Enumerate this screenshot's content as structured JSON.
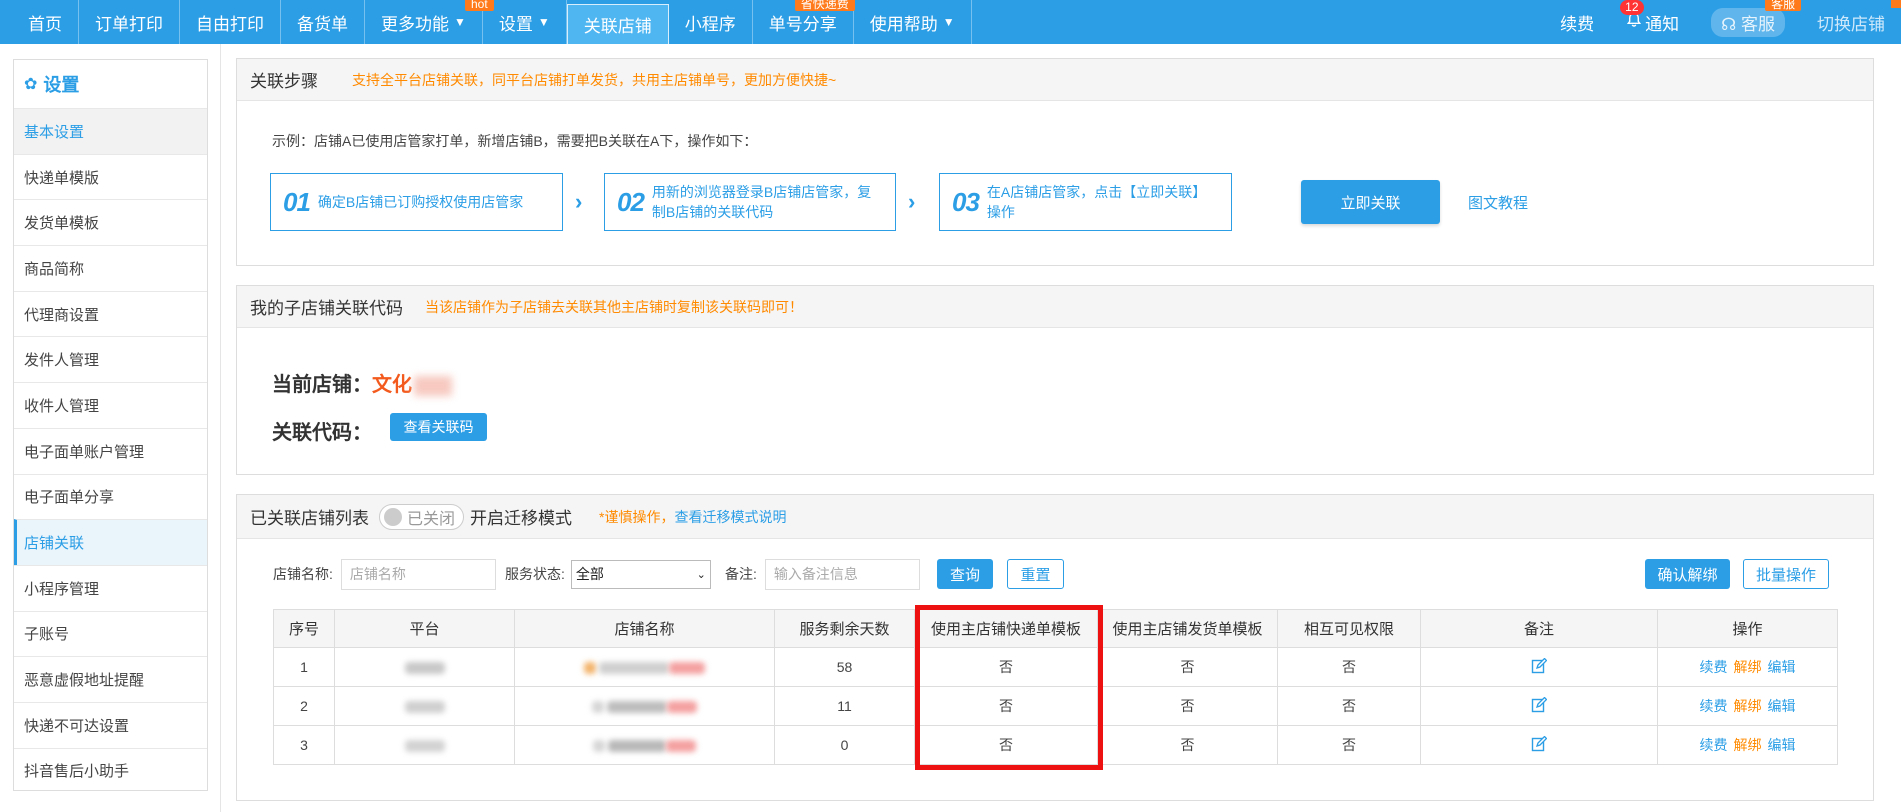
{
  "nav": {
    "items": [
      {
        "label": "首页"
      },
      {
        "label": "订单打印"
      },
      {
        "label": "自由打印"
      },
      {
        "label": "备货单"
      },
      {
        "label": "更多功能",
        "arrow": "▼",
        "badge": "hot"
      },
      {
        "label": "设置",
        "arrow": "▼"
      },
      {
        "label": "关联店铺",
        "active": true
      },
      {
        "label": "小程序"
      },
      {
        "label": "单号分享",
        "badge": "省快递费"
      },
      {
        "label": "使用帮助",
        "arrow": "▼"
      }
    ],
    "right": {
      "renew": "续费",
      "notify": "通知",
      "notify_count": "12",
      "kefu": "客服",
      "kefu_badge": "客服",
      "switch": "切换店铺"
    }
  },
  "sidebar": {
    "title": "设置",
    "items": [
      "基本设置",
      "快递单模版",
      "发货单模板",
      "商品简称",
      "代理商设置",
      "发件人管理",
      "收件人管理",
      "电子面单账户管理",
      "电子面单分享",
      "店铺关联",
      "小程序管理",
      "子账号",
      "恶意虚假地址提醒",
      "快递不可达设置",
      "抖音售后小助手"
    ],
    "active_index": 9
  },
  "steps_panel": {
    "title": "关联步骤",
    "hint": "支持全平台店铺关联，同平台店铺打单发货，共用主店铺单号，更加方便快捷~",
    "example": "示例：店铺A已使用店管家打单，新增店铺B，需要把B关联在A下，操作如下：",
    "steps": [
      {
        "num": "01",
        "text": "确定B店铺已订购授权使用店管家"
      },
      {
        "num": "02",
        "text": "用新的浏览器登录B店铺店管家，复制B店铺的关联代码"
      },
      {
        "num": "03",
        "text": "在A店铺店管家，点击【立即关联】操作"
      }
    ],
    "link_now": "立即关联",
    "tutorial": "图文教程"
  },
  "code_panel": {
    "title": "我的子店铺关联代码",
    "hint": "当该店铺作为子店铺去关联其他主店铺时复制该关联码即可！",
    "current_store_label": "当前店铺：",
    "current_store_value": "文化",
    "link_code_label": "关联代码：",
    "view_code_button": "查看关联码"
  },
  "list_panel": {
    "title": "已关联店铺列表",
    "toggle_label": "已关闭",
    "migrate_label": "开启迁移模式",
    "caution_prefix": "*谨慎操作，",
    "caution_link": "查看迁移模式说明",
    "filters": {
      "store_name_label": "店铺名称:",
      "store_name_placeholder": "店铺名称",
      "status_label": "服务状态:",
      "status_value": "全部",
      "remark_label": "备注:",
      "remark_placeholder": "输入备注信息",
      "query": "查询",
      "reset": "重置",
      "confirm_unbind": "确认解绑",
      "batch": "批量操作"
    },
    "columns": [
      "序号",
      "平台",
      "店铺名称",
      "服务剩余天数",
      "使用主店铺快递单模板",
      "使用主店铺发货单模板",
      "相互可见权限",
      "备注",
      "操作"
    ],
    "rows": [
      {
        "index": "1",
        "days": "58",
        "express": "否",
        "invoice": "否",
        "visible": "否"
      },
      {
        "index": "2",
        "days": "11",
        "express": "否",
        "invoice": "否",
        "visible": "否"
      },
      {
        "index": "3",
        "days": "0",
        "express": "否",
        "invoice": "否",
        "visible": "否"
      }
    ],
    "ops": {
      "renew": "续费",
      "unbind": "解绑",
      "edit": "编辑"
    }
  },
  "colors": {
    "brand": "#2b9ee6",
    "warning": "#ff8a00",
    "highlight": "#ee1111"
  }
}
